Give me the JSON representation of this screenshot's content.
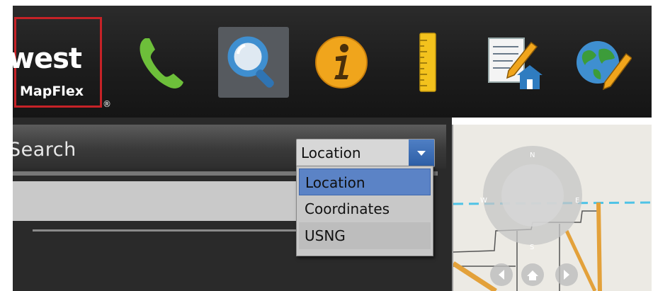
{
  "brand": {
    "logo_text": "west",
    "product": "MapFlex",
    "registered": "®"
  },
  "toolbar": {
    "tools": [
      {
        "icon": "phone-icon",
        "color": "#6dbf3a",
        "active": false
      },
      {
        "icon": "search-icon",
        "color": "#3f8fd0",
        "active": true
      },
      {
        "icon": "info-icon",
        "color": "#f0a51c",
        "active": false
      },
      {
        "icon": "ruler-icon",
        "color": "#f3c21d",
        "active": false
      },
      {
        "icon": "edit-document-icon",
        "color": "#2f7cc0",
        "active": false
      },
      {
        "icon": "globe-edit-icon",
        "color": "#3c9c3a",
        "active": false
      }
    ]
  },
  "search": {
    "title": "Search",
    "select": {
      "value": "Location",
      "options": [
        "Location",
        "Coordinates",
        "USNG"
      ],
      "highlighted": "Location"
    }
  },
  "map": {
    "compass": {
      "n": "N",
      "w": "W",
      "e": "E",
      "s": "S"
    }
  },
  "colors": {
    "logo_border": "#c62227",
    "selection": "#5b83c6",
    "toolbar_bg": "#1c1c1c"
  }
}
